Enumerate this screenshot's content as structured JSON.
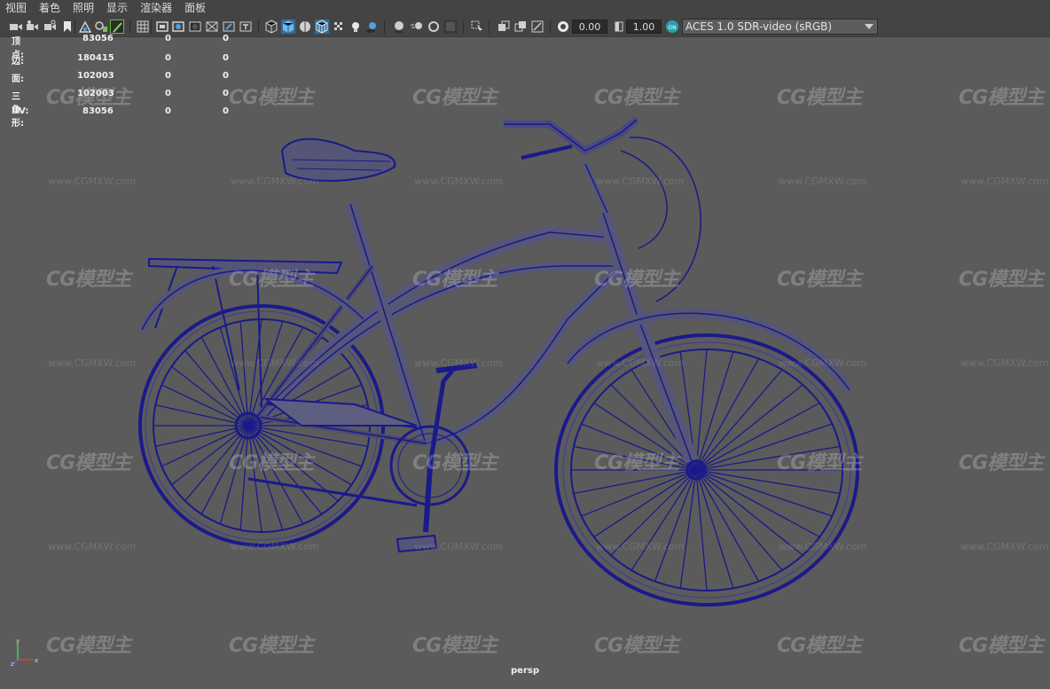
{
  "menu": [
    {
      "label": "视图"
    },
    {
      "label": "着色"
    },
    {
      "label": "照明"
    },
    {
      "label": "显示"
    },
    {
      "label": "渲染器"
    },
    {
      "label": "面板"
    }
  ],
  "toolbar": {
    "exposure_value": "0.00",
    "gamma_value": "1.00",
    "color_space": "ACES 1.0 SDR-video (sRGB)",
    "icons": [
      "camera-icon",
      "camera-attributes-icon",
      "bookmark-icon",
      "image-plane-icon",
      "grease-pencil-icon",
      "grid-icon",
      "film-gate-icon",
      "resolution-gate-icon",
      "gate-mask-icon",
      "field-chart-icon",
      "safe-action-icon",
      "wireframe-icon",
      "smooth-shade-icon",
      "wireframe-on-shaded-icon",
      "textured-icon",
      "use-all-lights-icon",
      "shadows-icon",
      "screen-space-ao-icon",
      "motion-blur-icon",
      "anti-aliasing-icon",
      "depth-of-field-icon",
      "isolate-select-icon",
      "xray-icon",
      "xray-active-icon",
      "xray-joints-icon",
      "exposure-icon",
      "gamma-icon",
      "color-management-icon"
    ]
  },
  "hud": {
    "rows": [
      {
        "label": "顶点:",
        "value": "83056",
        "selected": "0",
        "component": "0"
      },
      {
        "label": "边:",
        "value": "180415",
        "selected": "0",
        "component": "0"
      },
      {
        "label": "面:",
        "value": "102003",
        "selected": "0",
        "component": "0"
      },
      {
        "label": "三角形:",
        "value": "102003",
        "selected": "0",
        "component": "0"
      },
      {
        "label": "UV:",
        "value": "83056",
        "selected": "0",
        "component": "0"
      }
    ]
  },
  "viewport": {
    "camera": "persp",
    "background_color": "#5b5b5b",
    "wireframe_color": "#1a1a8a",
    "axis_labels": {
      "x": "x",
      "y": "y",
      "z": "z"
    }
  },
  "watermark": {
    "logo": "CG模型主",
    "url": "www.CGMXW.com"
  }
}
